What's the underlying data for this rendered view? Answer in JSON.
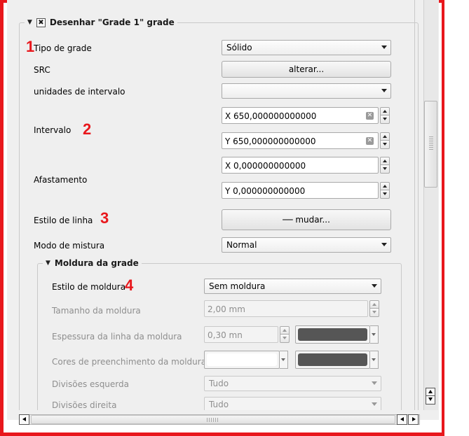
{
  "group_main": {
    "title": "Desenhar \"Grade 1\" grade",
    "checked_mark": "✖"
  },
  "rows": {
    "tipo": {
      "label": "Tipo de grade",
      "value": "Sólido"
    },
    "src": {
      "label": "SRC",
      "button": "alterar..."
    },
    "unidades": {
      "label": "unidades de intervalo",
      "value": ""
    },
    "intervalo": {
      "label": "Intervalo",
      "x": "X 650,000000000000",
      "y": "Y 650,000000000000"
    },
    "afastamento": {
      "label": "Afastamento",
      "x": "X 0,000000000000",
      "y": "Y 0,000000000000"
    },
    "estilo_linha": {
      "label": "Estilo de linha",
      "button": "── mudar..."
    },
    "modo": {
      "label": "Modo de mistura",
      "value": "Normal"
    }
  },
  "frame_group": {
    "title": "Moldura da grade",
    "estilo": {
      "label": "Estilo de moldura",
      "value": "Sem moldura"
    },
    "tamanho": {
      "label": "Tamanho da moldura",
      "value": "2,00 mm"
    },
    "espessura": {
      "label": "Espessura da linha da moldura",
      "value": "0,30 mn"
    },
    "cores": {
      "label": "Cores de preenchimento da moldura"
    },
    "div_esq": {
      "label": "Divisões esquerda",
      "value": "Tudo"
    },
    "div_dir": {
      "label": "Divisões direita",
      "value": "Tudo"
    }
  },
  "annotations": {
    "n1": "1",
    "n2": "2",
    "n3": "3",
    "n4": "4"
  },
  "colors": {
    "annotation": "#e8171c",
    "frame_line": "#565656",
    "frame_fill": "#ffffff"
  }
}
